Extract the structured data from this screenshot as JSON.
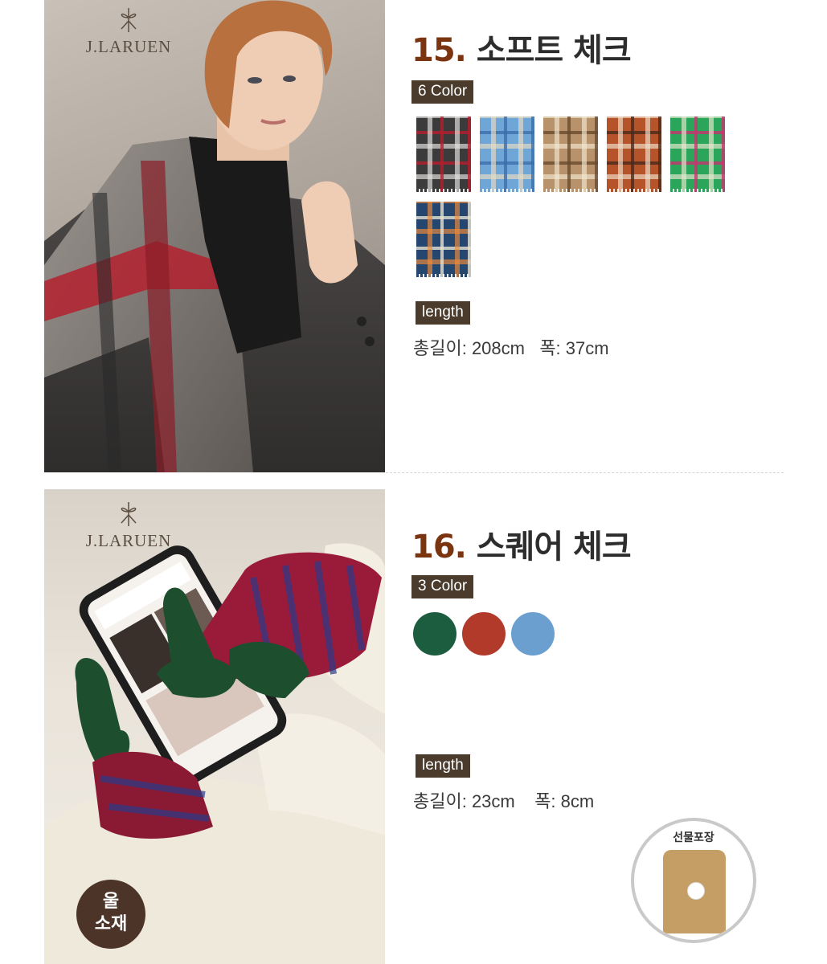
{
  "brand": {
    "logo_text": "J.LARUEN"
  },
  "products": [
    {
      "number": "15.",
      "name": "소프트 체크",
      "color_tag": "6 Color",
      "length_tag": "length",
      "length_text": "총길이: 208cm   폭: 37cm",
      "swatches": [
        {
          "name": "black-grey-check",
          "base": "#3b3b3b",
          "stripe": "#e6e3e0",
          "accent": "#b51d2e"
        },
        {
          "name": "blue-check",
          "base": "#6ea6d8",
          "stripe": "#e9dcc0",
          "accent": "#3d6eab"
        },
        {
          "name": "beige-brown-check",
          "base": "#b8926a",
          "stripe": "#f1e7cf",
          "accent": "#6a4a2e"
        },
        {
          "name": "orange-brown-check",
          "base": "#b5532a",
          "stripe": "#f0e0cc",
          "accent": "#4a2a1a"
        },
        {
          "name": "green-pink-check",
          "base": "#2aa65a",
          "stripe": "#e9e7d0",
          "accent": "#c8336f"
        },
        {
          "name": "orange-navy-check",
          "base": "#25466f",
          "stripe": "#f08b3a",
          "accent": "#e7e2d2"
        }
      ]
    },
    {
      "number": "16.",
      "name": "스퀘어 체크",
      "color_tag": "3 Color",
      "length_tag": "length",
      "length_text": "총길이: 23cm    폭: 8cm",
      "swatches": [
        {
          "name": "green",
          "color": "#1c5c3f"
        },
        {
          "name": "red",
          "color": "#b23a2b"
        },
        {
          "name": "blue",
          "color": "#6a9fd0"
        }
      ]
    }
  ],
  "gift": {
    "label": "선물포장"
  },
  "material_badge": {
    "line1": "울",
    "line2": "소재"
  }
}
